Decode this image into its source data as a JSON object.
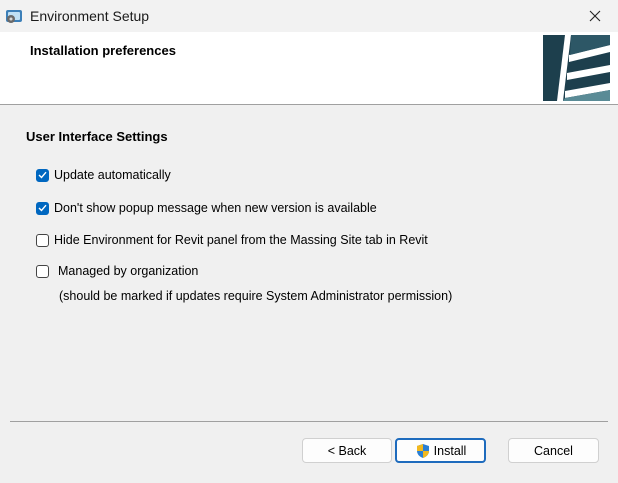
{
  "window": {
    "title": "Environment Setup",
    "app_icon": "installer-icon",
    "close_icon": "close-icon"
  },
  "banner": {
    "title": "Installation preferences",
    "logo": "environment-logo"
  },
  "section": {
    "title": "User Interface Settings"
  },
  "options": [
    {
      "label": "Update automatically",
      "checked": true
    },
    {
      "label": "Don't show popup message when new version is available",
      "checked": true
    },
    {
      "label": "Hide Environment for Revit panel from the Massing  Site tab in Revit",
      "checked": false
    },
    {
      "label": "Managed by organization",
      "checked": false
    }
  ],
  "managed_note": "(should be marked if updates require System Administrator permission)",
  "buttons": {
    "back": "< Back",
    "install": "Install",
    "cancel": "Cancel"
  },
  "colors": {
    "accent": "#0067c0",
    "logo_dark": "#1d3f4d",
    "logo_light": "#5a8b96"
  }
}
